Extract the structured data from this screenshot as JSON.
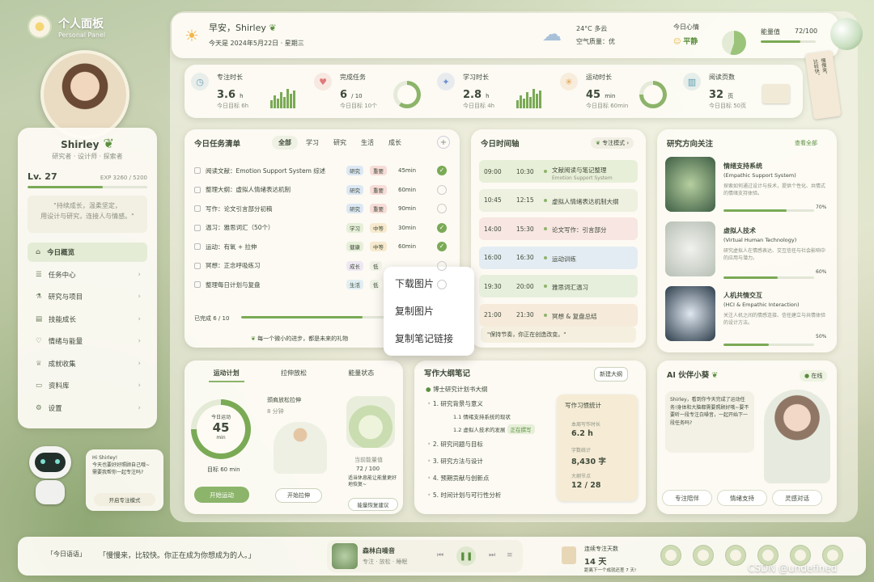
{
  "logo": {
    "title": "个人面板",
    "subtitle": "Personal Panel"
  },
  "profile": {
    "name": "Shirley",
    "roles": "研究者 · 设计师 · 探索者",
    "level": "Lv. 27",
    "exp": "EXP 3260 / 5200",
    "exp_fraction": 0.63,
    "quote": "\"持续成长，温柔坚定，\n用设计与研究，连接人与情感。\""
  },
  "nav": [
    {
      "label": "今日概览",
      "icon": "home-icon",
      "active": true
    },
    {
      "label": "任务中心",
      "icon": "list-icon"
    },
    {
      "label": "研究与项目",
      "icon": "flask-icon"
    },
    {
      "label": "技能成长",
      "icon": "chart-icon"
    },
    {
      "label": "情绪与能量",
      "icon": "heart-icon"
    },
    {
      "label": "成就收集",
      "icon": "trophy-icon"
    },
    {
      "label": "资料库",
      "icon": "folder-icon"
    },
    {
      "label": "设置",
      "icon": "gear-icon"
    }
  ],
  "robot_bubble": {
    "text": "Hi Shirley!\n今天也要好好照顾自己哦~\n需要我帮你一起专注吗?",
    "button": "开启专注模式"
  },
  "header": {
    "greeting": "早安，Shirley",
    "date": "今天是 2024年5月22日 · 星期三",
    "weather_temp": "24°C 多云",
    "air": "空气质量：优",
    "mood_label": "今日心情",
    "mood": "平静",
    "energy_label": "能量值",
    "energy_value": "72/100",
    "energy_fraction": 0.72
  },
  "tag_card": "慢慢来，\n比较快。",
  "stats": [
    {
      "title": "专注时长",
      "value": "3.6",
      "unit": "h",
      "goal": "今日目标 6h",
      "icon": "clock-icon",
      "color": "#6fa3b8",
      "viz": "bars"
    },
    {
      "title": "完成任务",
      "value": "6",
      "unit": "/ 10",
      "goal": "今日目标 10个",
      "icon": "heart-icon",
      "color": "#e07a7a",
      "viz": "ring",
      "fraction": 0.6
    },
    {
      "title": "学习时长",
      "value": "2.8",
      "unit": "h",
      "goal": "今日目标 4h",
      "icon": "bird-icon",
      "color": "#6b8fd0",
      "viz": "bars"
    },
    {
      "title": "运动时长",
      "value": "45",
      "unit": "min",
      "goal": "今日目标 60min",
      "icon": "runner-icon",
      "color": "#e0a04a",
      "viz": "ring",
      "fraction": 0.75
    },
    {
      "title": "阅读页数",
      "value": "32",
      "unit": "页",
      "goal": "今日目标 50页",
      "icon": "book-icon",
      "color": "#5a9ab0",
      "viz": "book"
    }
  ],
  "tasks": {
    "title": "今日任务清单",
    "tabs": [
      "全部",
      "学习",
      "研究",
      "生活",
      "成长"
    ],
    "items": [
      {
        "text": "阅读文献：Emotion Support System 综述",
        "tag": "研究",
        "level": "重要",
        "time": "45min",
        "done": true
      },
      {
        "text": "整理大纲：虚拟人情绪表达机制",
        "tag": "研究",
        "level": "重要",
        "time": "60min",
        "done": false
      },
      {
        "text": "写作：论文引言部分初稿",
        "tag": "研究",
        "level": "重要",
        "time": "90min",
        "done": false
      },
      {
        "text": "温习：雅思词汇（50个）",
        "tag": "学习",
        "level": "中等",
        "time": "30min",
        "done": true
      },
      {
        "text": "运动：有氧 + 拉伸",
        "tag": "健康",
        "level": "中等",
        "time": "60min",
        "done": true
      },
      {
        "text": "冥想：正念呼吸练习",
        "tag": "成长",
        "level": "低",
        "time": "",
        "done": false
      },
      {
        "text": "整理每日计划与复盘",
        "tag": "生活",
        "level": "低",
        "time": "",
        "done": false
      }
    ],
    "progress_label": "已完成 6 / 10",
    "progress_fraction": 0.6,
    "footer": "每一个微小的进步，都是未来的礼物"
  },
  "context_menu": [
    "下载图片",
    "复制图片",
    "复制笔记链接"
  ],
  "timeline": {
    "title": "今日时间轴",
    "mode": "专注模式",
    "items": [
      {
        "start": "09:00",
        "end": "10:30",
        "title": "文献阅读与笔记整理",
        "sub": "Emotion Support System",
        "color": "#e8efd8"
      },
      {
        "start": "10:45",
        "end": "12:15",
        "title": "虚拟人情绪表达机制大纲",
        "sub": "",
        "color": "#eef0e0"
      },
      {
        "start": "14:00",
        "end": "15:30",
        "title": "论文写作：引言部分",
        "sub": "",
        "color": "#f7e6e2"
      },
      {
        "start": "16:00",
        "end": "16:30",
        "title": "运动训练",
        "sub": "",
        "color": "#e4ecf3"
      },
      {
        "start": "19:30",
        "end": "20:00",
        "title": "雅思词汇温习",
        "sub": "",
        "color": "#e6efdb"
      },
      {
        "start": "21:00",
        "end": "21:30",
        "title": "冥想 & 复盘总结",
        "sub": "",
        "color": "#f6eadb"
      }
    ],
    "quote": "\"保持节奏，你正在创造改变。\""
  },
  "research": {
    "title": "研究方向关注",
    "more": "查看全部",
    "items": [
      {
        "title": "情绪支持系统",
        "en": "(Empathic Support System)",
        "desc": "探索如何通过设计与技术，提供个性化、共情式的情绪支持体验。",
        "pct": "70%",
        "fraction": 0.7
      },
      {
        "title": "虚拟人技术",
        "en": "(Virtual Human Technology)",
        "desc": "研究虚拟人在情感表达、交互信任与社会影响中的应用与潜力。",
        "pct": "60%",
        "fraction": 0.6
      },
      {
        "title": "人机共情交互",
        "en": "(HCI & Empathic Interaction)",
        "desc": "关注人机之间的情感连接、信任建立与共情体验的设计方法。",
        "pct": "50%",
        "fraction": 0.5
      }
    ]
  },
  "exercise": {
    "tabs": [
      "运动计划",
      "拉伸放松",
      "能量状态"
    ],
    "ring_label": "今日运动",
    "ring_value": "45",
    "ring_unit": "min",
    "ring_fraction": 0.75,
    "goal": "目标 60 min",
    "button": "开始运动",
    "stretch_title": "颈肩放松拉伸",
    "stretch_time": "8 分钟",
    "stretch_button": "开始拉伸",
    "energy_label": "当前能量值",
    "energy_value": "72 / 100",
    "energy_tip": "适当休息能让能量更好地恢复~",
    "energy_button": "能量恢复建议"
  },
  "outline": {
    "title": "写作大纲笔记",
    "button": "新建大纲",
    "root": "博士研究计划书大纲",
    "items": [
      {
        "n": "1.",
        "t": "研究背景与意义",
        "sub": [
          {
            "n": "1.1",
            "t": "情绪支持系统的现状"
          },
          {
            "n": "1.2",
            "t": "虚拟人技术的发展",
            "badge": "正在撰写"
          }
        ]
      },
      {
        "n": "2.",
        "t": "研究问题与目标"
      },
      {
        "n": "3.",
        "t": "研究方法与设计"
      },
      {
        "n": "4.",
        "t": "预期贡献与创新点"
      },
      {
        "n": "5.",
        "t": "时间计划与可行性分析"
      }
    ]
  },
  "writing_stats": {
    "title": "写作习惯统计",
    "rows": [
      {
        "label": "本周写作时长",
        "value": "6.2 h"
      },
      {
        "label": "字数统计",
        "value": "8,430 字"
      },
      {
        "label": "大纲节点",
        "value": "12 / 28"
      }
    ]
  },
  "ai": {
    "title": "AI 伙伴小葵",
    "status": "在线",
    "message": "Shirley，看到你今天完成了运动任务!身体和大脑都需要照顾好哦~要不要听一段专注白噪音，一起开始下一段任务吗?",
    "buttons": [
      "专注陪伴",
      "情绪支持",
      "灵感对话"
    ]
  },
  "footer": {
    "label": "「今日语语」",
    "quote": "「慢慢来，比较快。你正在成为你想成为的人。」",
    "music_title": "森林白噪音",
    "music_sub": "专注 · 放松 · 睡眠",
    "streak_label": "连续专注天数",
    "streak_value": "14 天",
    "streak_sub": "距离下一个成就还差 7 天!",
    "watermark": "CSDN @undefined"
  }
}
